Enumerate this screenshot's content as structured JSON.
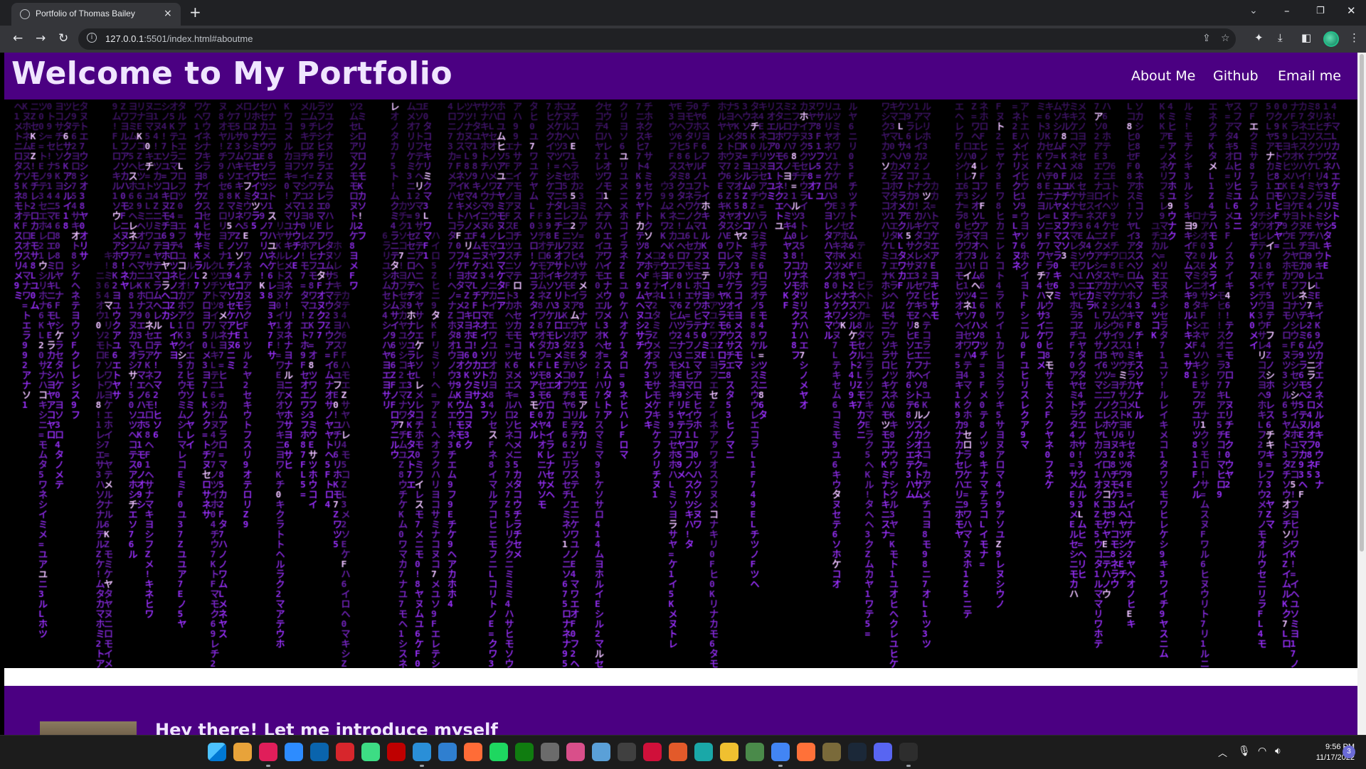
{
  "browser": {
    "tab_title": "Portfolio of Thomas Bailey",
    "tab_close": "×",
    "new_tab": "+",
    "url_host": "127.0.0.1",
    "url_rest": ":5501/index.html#aboutme"
  },
  "page": {
    "site_title": "Welcome to My Portfolio",
    "nav": [
      "About Me",
      "Github",
      "Email me"
    ],
    "about_heading": "Hey there! Let me introduce myself",
    "header_color": "#4b0082",
    "matrix_color": "#9b30ff"
  },
  "taskbar": {
    "time": "9:56 PM",
    "date": "11/17/2022",
    "notification_count": "3",
    "apps": [
      "windows-start",
      "git-client",
      "slack",
      "zoom",
      "outlook",
      "adobe-acrobat",
      "android-emulator",
      "filezilla",
      "vscode",
      "edge-dev",
      "postman",
      "spotify",
      "xbox",
      "calculator",
      "screenshot-tool",
      "control-panel",
      "obs",
      "f1-app",
      "davinci",
      "terminal-app",
      "file-explorer",
      "task-manager",
      "chrome",
      "firefox",
      "intellij",
      "steam",
      "discord",
      "windows-terminal"
    ]
  }
}
